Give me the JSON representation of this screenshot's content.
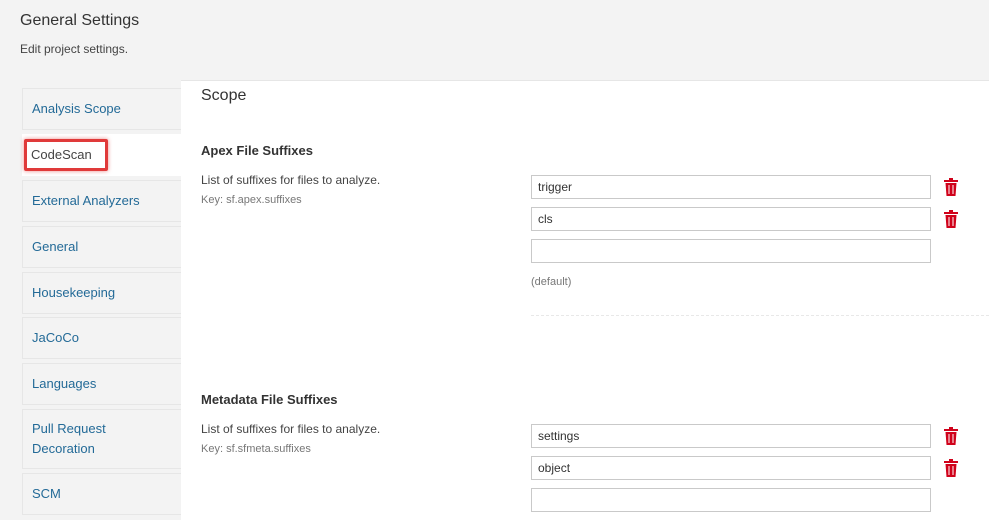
{
  "header": {
    "title": "General Settings",
    "subtitle": "Edit project settings."
  },
  "sidebar": {
    "items": [
      {
        "label": "Analysis Scope"
      },
      {
        "label": "CodeScan"
      },
      {
        "label": "External Analyzers"
      },
      {
        "label": "General"
      },
      {
        "label": "Housekeeping"
      },
      {
        "label": "JaCoCo"
      },
      {
        "label": "Languages"
      },
      {
        "label": "Pull Request Decoration"
      },
      {
        "label": "SCM"
      }
    ]
  },
  "main": {
    "section_title": "Scope",
    "settings": [
      {
        "title": "Apex File Suffixes",
        "description": "List of suffixes for files to analyze.",
        "key": "Key: sf.apex.suffixes",
        "values": [
          "trigger",
          "cls",
          ""
        ],
        "default_note": "(default)"
      },
      {
        "title": "Metadata File Suffixes",
        "description": "List of suffixes for files to analyze.",
        "key": "Key: sf.sfmeta.suffixes",
        "values": [
          "settings",
          "object",
          ""
        ]
      }
    ]
  },
  "colors": {
    "link": "#236a97",
    "delete_icon": "#d0021b",
    "highlight_box": "#e03a3a"
  },
  "icons": {
    "delete": "trash-icon"
  }
}
